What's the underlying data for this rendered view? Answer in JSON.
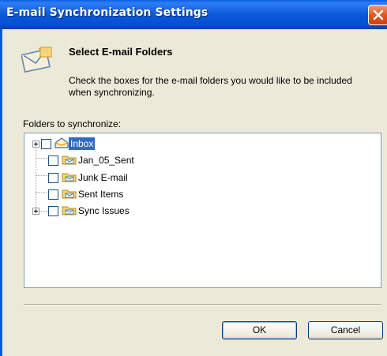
{
  "window": {
    "title": "E-mail Synchronization Settings"
  },
  "header": {
    "title": "Select E-mail Folders",
    "description": "Check the boxes for the e-mail folders you would like to be included when synchronizing."
  },
  "folders_label": "Folders to synchronize:",
  "tree": [
    {
      "label": "Inbox",
      "expandable": true,
      "checked": false,
      "selected": true,
      "icon": "inbox-icon",
      "level": 0
    },
    {
      "label": "Jan_05_Sent",
      "expandable": false,
      "checked": false,
      "selected": false,
      "icon": "folder-icon",
      "level": 1
    },
    {
      "label": "Junk E-mail",
      "expandable": false,
      "checked": false,
      "selected": false,
      "icon": "folder-icon",
      "level": 1
    },
    {
      "label": "Sent Items",
      "expandable": false,
      "checked": false,
      "selected": false,
      "icon": "folder-icon",
      "level": 1
    },
    {
      "label": "Sync Issues",
      "expandable": true,
      "checked": false,
      "selected": false,
      "icon": "folder-icon",
      "level": 0
    }
  ],
  "buttons": {
    "ok": "OK",
    "cancel": "Cancel"
  },
  "colors": {
    "titlebar": "#0b58d8",
    "dialog_bg": "#ece9d8",
    "selection": "#316ac5",
    "close": "#e2571f"
  }
}
